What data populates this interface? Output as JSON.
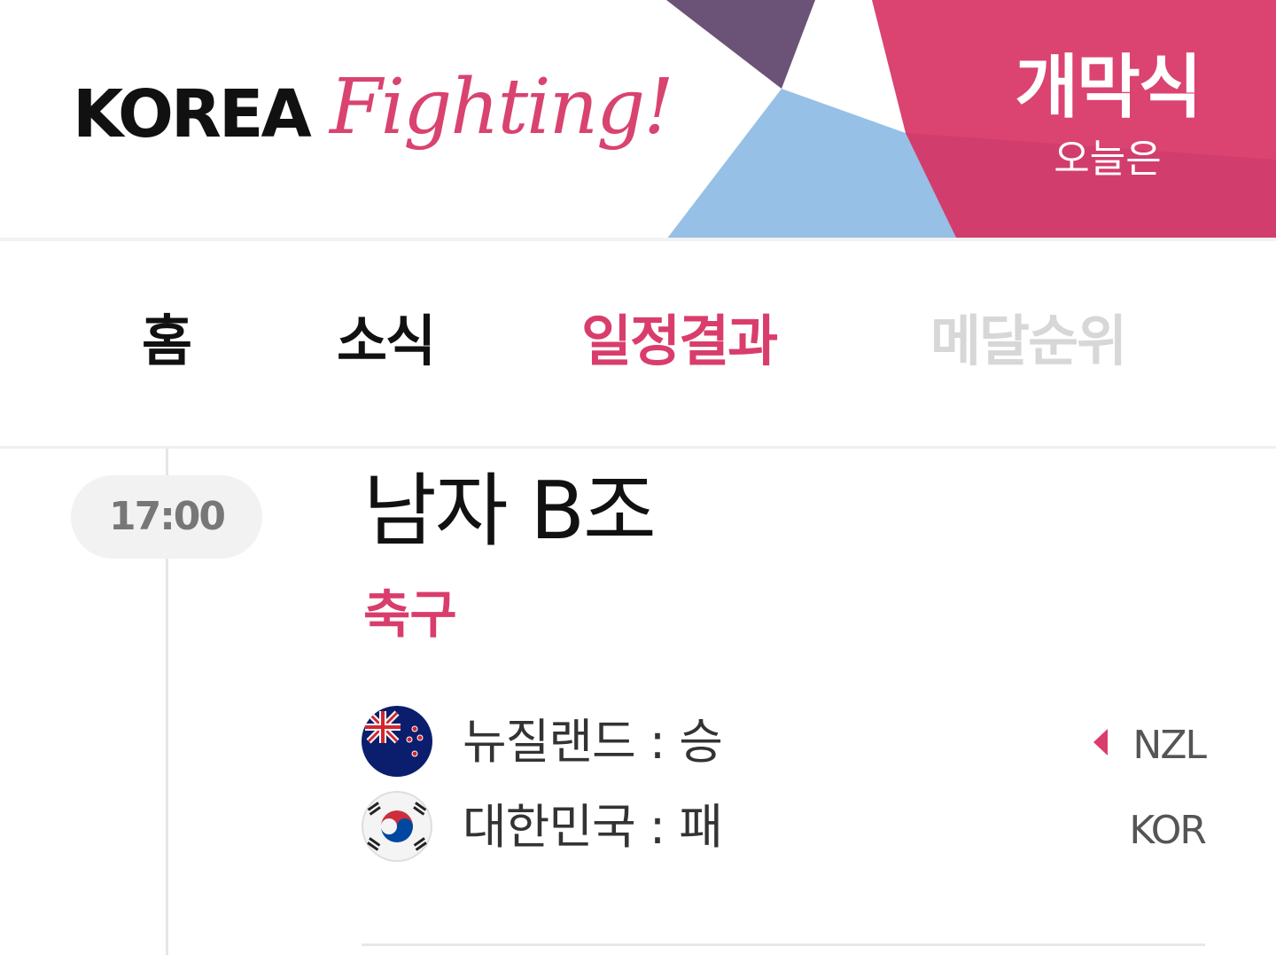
{
  "header": {
    "logo_korea": "KOREA",
    "logo_fighting": "Fighting!",
    "today_title": "개막식",
    "today_sub": "오늘은",
    "colors": {
      "brand_pink": "#d9436f",
      "purple": "#6b5377",
      "light_blue": "#96c0e6"
    }
  },
  "tabs": [
    {
      "label": "홈",
      "active": false
    },
    {
      "label": "소식",
      "active": false
    },
    {
      "label": "일정결과",
      "active": true
    },
    {
      "label": "메달순위",
      "active": false
    }
  ],
  "event": {
    "time": "17:00",
    "title": "남자 B조",
    "sport": "축구",
    "teams": [
      {
        "label": "뉴질랜드 : 승",
        "code": "NZL",
        "flag_icon": "new-zealand-flag-icon",
        "winner": true
      },
      {
        "label": "대한민국 : 패",
        "code": "KOR",
        "flag_icon": "south-korea-flag-icon",
        "winner": false
      }
    ]
  }
}
